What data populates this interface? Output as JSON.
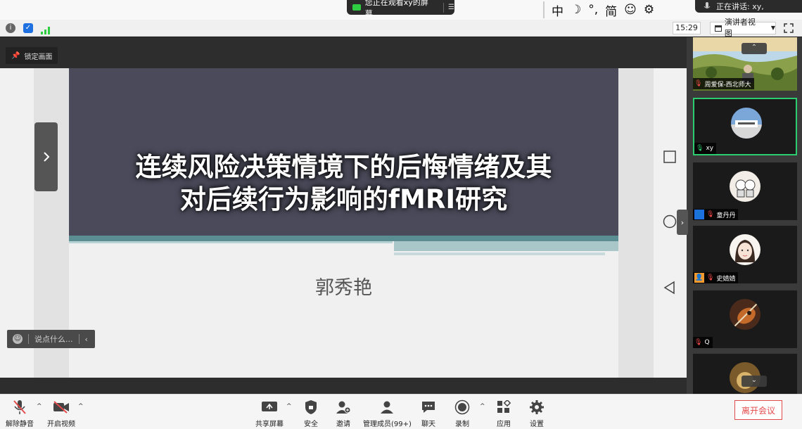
{
  "top": {
    "watching_text": "您正在观看xy的屏幕",
    "ime": {
      "lang": "中",
      "punct": "°,",
      "script": "简"
    },
    "speaking_text": "正在讲话: xy,"
  },
  "infobar": {
    "clock": "15:29",
    "view_mode": "演讲者视图"
  },
  "stage": {
    "lock_label": "锁定画面",
    "slide_title_line1": "连续风险决策情境下的后悔情绪及其",
    "slide_title_line2": "对后续行为影响的fMRI研究",
    "slide_author": "郭秀艳",
    "chat_placeholder": "说点什么..."
  },
  "participants": [
    {
      "name": "周爱保-西北师大",
      "muted": true,
      "type": "landscape"
    },
    {
      "name": "xy",
      "muted": false,
      "talking": true,
      "type": "avatar-building"
    },
    {
      "name": "童丹丹",
      "muted": true,
      "host": true,
      "type": "avatar-cartoon"
    },
    {
      "name": "史婧婧",
      "muted": true,
      "cohost": true,
      "type": "avatar-girl"
    },
    {
      "name": "Q",
      "muted": true,
      "type": "avatar-guitar"
    },
    {
      "name": "",
      "muted": true,
      "type": "avatar-partial"
    }
  ],
  "toolbar": {
    "unmute": "解除静音",
    "start_video": "开启视频",
    "share": "共享屏幕",
    "security": "安全",
    "invite": "邀请",
    "participants": "管理成员(99+)",
    "chat": "聊天",
    "record": "录制",
    "apps": "应用",
    "settings": "设置",
    "leave": "离开会议"
  },
  "colors": {
    "accent_green": "#2ecc71",
    "leave_red": "#e34a4a",
    "slide_dark": "#4a4a5a",
    "slide_teal": "#5a8e92"
  }
}
